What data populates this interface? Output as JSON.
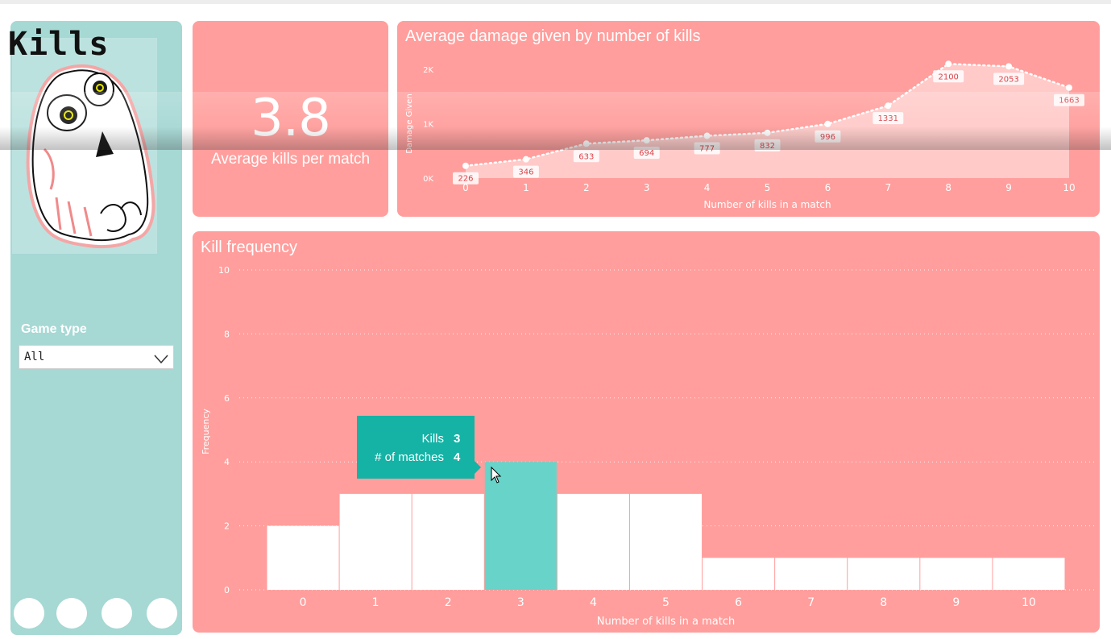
{
  "page": {
    "title": "Kills"
  },
  "slicer": {
    "label": "Game type",
    "value": "All"
  },
  "nav_dots": [
    {
      "name": "nav-dot-1"
    },
    {
      "name": "nav-dot-2"
    },
    {
      "name": "nav-dot-3"
    },
    {
      "name": "nav-dot-4"
    }
  ],
  "kpi": {
    "value": "3.8",
    "label": "Average kills per match"
  },
  "tooltip": {
    "kills_label": "Kills",
    "kills_value": "3",
    "matches_label": "# of matches",
    "matches_value": "4"
  },
  "icons": {
    "logo": "skull-icon",
    "slicer_chevron": "chevron-down-icon",
    "pointer": "mouse-pointer-icon"
  },
  "colors": {
    "card": "#ff9e9c",
    "sidebar": "#a6d8d4",
    "highlight": "#68d3c9",
    "tooltip": "#14b3a6"
  },
  "chart_data": [
    {
      "type": "area",
      "title": "Average damage given by number of kills",
      "xlabel": "Number of kills in a match",
      "ylabel": "Damage Given",
      "x": [
        0,
        1,
        2,
        3,
        4,
        5,
        6,
        7,
        8,
        9,
        10
      ],
      "values": [
        226,
        346,
        633,
        694,
        777,
        832,
        996,
        1331,
        2100,
        2053,
        1663
      ],
      "ylim": [
        0,
        2000
      ],
      "yticks": [
        0,
        1000,
        2000
      ],
      "ytick_labels": [
        "0K",
        "1K",
        "2K"
      ],
      "data_labels": true,
      "grid": false
    },
    {
      "type": "bar",
      "title": "Kill frequency",
      "xlabel": "Number of kills in a match",
      "ylabel": "Frequency",
      "categories": [
        "0",
        "1",
        "2",
        "3",
        "4",
        "5",
        "6",
        "7",
        "8",
        "9",
        "10"
      ],
      "values": [
        2,
        3,
        3,
        4,
        3,
        3,
        1,
        1,
        1,
        1,
        1
      ],
      "highlighted_category": "3",
      "ylim": [
        0,
        10
      ],
      "yticks": [
        0,
        2,
        4,
        6,
        8,
        10
      ],
      "grid": true
    }
  ]
}
